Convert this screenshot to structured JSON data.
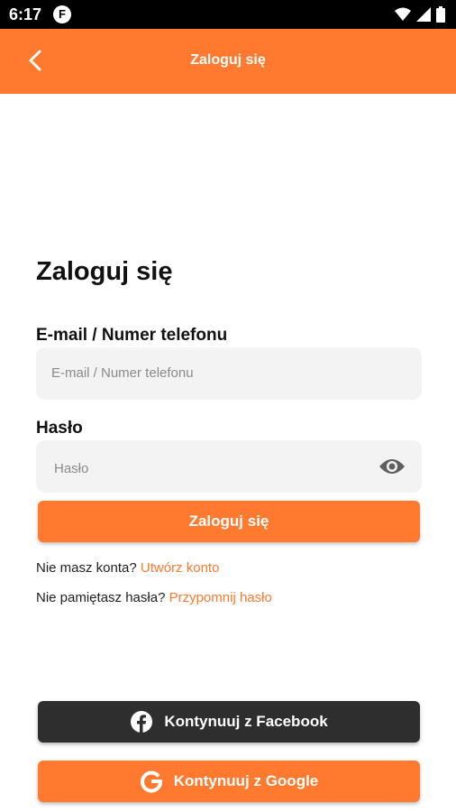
{
  "status_bar": {
    "time": "6:17",
    "app_icon_letter": "F"
  },
  "app_bar": {
    "title": "Zaloguj się"
  },
  "login_form": {
    "heading": "Zaloguj się",
    "email_label": "E-mail / Numer telefonu",
    "email_placeholder": "E-mail / Numer telefonu",
    "password_label": "Hasło",
    "password_placeholder": "Hasło",
    "submit_label": "Zaloguj się"
  },
  "helpers": {
    "no_account_text": "Nie masz konta?",
    "create_account_link": "Utwórz konto",
    "forgot_text": "Nie pamiętasz hasła?",
    "remind_password_link": "Przypomnij hasło"
  },
  "social": {
    "facebook_label": "Kontynuuj z Facebook",
    "google_label": "Kontynuuj z Google"
  },
  "colors": {
    "accent": "#ff7a2f",
    "dark_button": "#2e2e2e",
    "input_bg": "#f3f3f3"
  }
}
